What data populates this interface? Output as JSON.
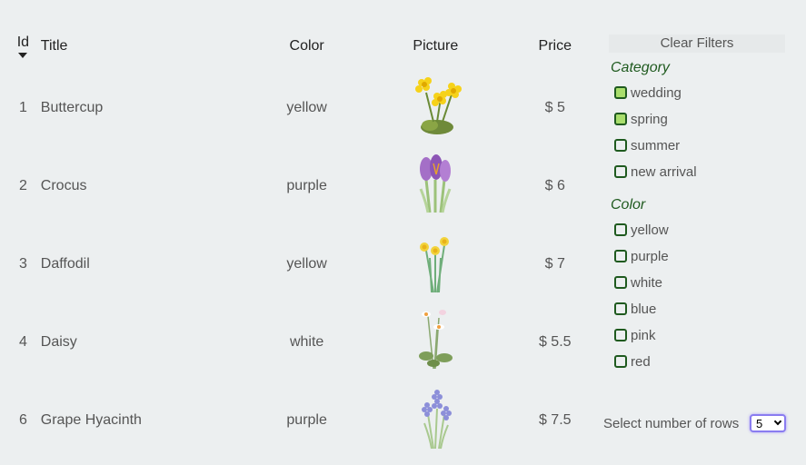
{
  "table": {
    "headers": {
      "id": "Id",
      "title": "Title",
      "color": "Color",
      "picture": "Picture",
      "price": "Price"
    },
    "rows": [
      {
        "id": "1",
        "title": "Buttercup",
        "color": "yellow",
        "picture": "buttercup-icon",
        "price": "$ 5"
      },
      {
        "id": "2",
        "title": "Crocus",
        "color": "purple",
        "picture": "crocus-icon",
        "price": "$ 6"
      },
      {
        "id": "3",
        "title": "Daffodil",
        "color": "yellow",
        "picture": "daffodil-icon",
        "price": "$ 7"
      },
      {
        "id": "4",
        "title": "Daisy",
        "color": "white",
        "picture": "daisy-icon",
        "price": "$ 5.5"
      },
      {
        "id": "6",
        "title": "Grape Hyacinth",
        "color": "purple",
        "picture": "grape-hyacinth-icon",
        "price": "$ 7.5"
      }
    ]
  },
  "filters": {
    "clear_label": "Clear Filters",
    "category_title": "Category",
    "category_options": [
      {
        "label": "wedding",
        "checked": true
      },
      {
        "label": "spring",
        "checked": true
      },
      {
        "label": "summer",
        "checked": false
      },
      {
        "label": "new arrival",
        "checked": false
      }
    ],
    "color_title": "Color",
    "color_options": [
      {
        "label": "yellow",
        "checked": false
      },
      {
        "label": "purple",
        "checked": false
      },
      {
        "label": "white",
        "checked": false
      },
      {
        "label": "blue",
        "checked": false
      },
      {
        "label": "pink",
        "checked": false
      },
      {
        "label": "red",
        "checked": false
      }
    ]
  },
  "pagination": {
    "rows_label": "Select number of rows",
    "rows_value": "5"
  },
  "colors": {
    "accent_green": "#1f5a1f",
    "checked_fill": "#a9de6c",
    "select_border": "#8a7cf0"
  }
}
